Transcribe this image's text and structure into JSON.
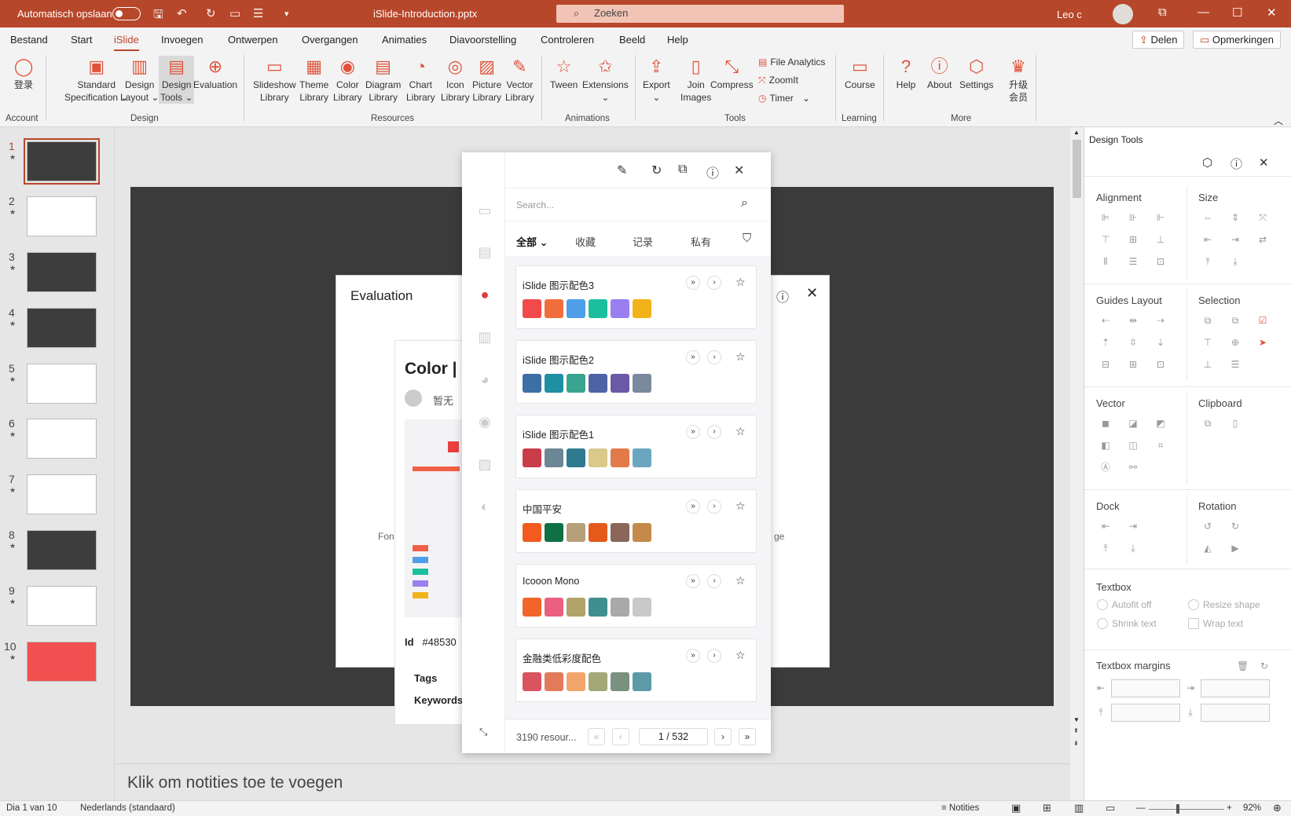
{
  "titlebar": {
    "autosave_label": "Automatisch opslaan",
    "filename": "iSlide-Introduction.pptx",
    "search_placeholder": "Zoeken",
    "user_name": "Leo c"
  },
  "menu": {
    "items": [
      "Bestand",
      "Start",
      "iSlide",
      "Invoegen",
      "Ontwerpen",
      "Overgangen",
      "Animaties",
      "Diavoorstelling",
      "Controleren",
      "Beeld",
      "Help"
    ],
    "active": "iSlide",
    "share_label": "Delen",
    "comments_label": "Opmerkingen"
  },
  "ribbon": {
    "account": {
      "login": "登录",
      "group": "Account"
    },
    "design": {
      "standard_1": "Standard",
      "standard_2": "Specification",
      "layout_1": "Design",
      "layout_2": "Layout",
      "tools_1": "Design",
      "tools_2": "Tools",
      "evaluation": "Evaluation",
      "group": "Design"
    },
    "resources": {
      "items": [
        [
          "Slideshow",
          "Library"
        ],
        [
          "Theme",
          "Library"
        ],
        [
          "Color",
          "Library"
        ],
        [
          "Diagram",
          "Library"
        ],
        [
          "Chart",
          "Library"
        ],
        [
          "Icon",
          "Library"
        ],
        [
          "Picture",
          "Library"
        ],
        [
          "Vector",
          "Library"
        ]
      ],
      "group": "Resources"
    },
    "animations": {
      "tween": "Tween",
      "extensions": "Extensions",
      "group": "Animations"
    },
    "tools": {
      "export": "Export",
      "join_1": "Join",
      "join_2": "Images",
      "compress": "Compress",
      "file_analytics": "File Analytics",
      "zoomit": "ZoomIt",
      "timer": "Timer",
      "group": "Tools"
    },
    "learning": {
      "course": "Course",
      "group": "Learning"
    },
    "more": {
      "help": "Help",
      "about": "About",
      "settings": "Settings",
      "upgrade_1": "升级",
      "upgrade_2": "会员",
      "group": "More"
    }
  },
  "thumbnails": [
    "1",
    "2",
    "3",
    "4",
    "5",
    "6",
    "7",
    "8",
    "9",
    "10"
  ],
  "evaluation": {
    "title": "Evaluation",
    "card_title": "Color |",
    "card_user": "暂无",
    "card_id_label": "Id",
    "card_id_value": "#48530",
    "tags_label": "Tags",
    "keywords_label": "Keywords",
    "left_cut": "Fon",
    "right_cut": "ge"
  },
  "library_panel": {
    "search_placeholder": "Search...",
    "tabs": [
      "全部",
      "收藏",
      "记录",
      "私有"
    ],
    "palettes": [
      {
        "name": "iSlide 图示配色3",
        "colors": [
          "#f24a4a",
          "#f26d3d",
          "#4f9ee8",
          "#1bbf9e",
          "#9a7ff0",
          "#f2b21a"
        ]
      },
      {
        "name": "iSlide 图示配色2",
        "colors": [
          "#3d6fa6",
          "#1f8fa3",
          "#3aa58f",
          "#4f62a6",
          "#6c5aa6",
          "#7a8a9c"
        ]
      },
      {
        "name": "iSlide 图示配色1",
        "colors": [
          "#c93c4a",
          "#6b8694",
          "#2f7a8f",
          "#d9c98a",
          "#e37a4a",
          "#6aa7bf"
        ]
      },
      {
        "name": "中国平安",
        "colors": [
          "#f25a1f",
          "#0f7044",
          "#b5a07a",
          "#e5591b",
          "#8a6758",
          "#c48a4a"
        ]
      },
      {
        "name": "Icooon Mono",
        "colors": [
          "#f2652a",
          "#ec5f7f",
          "#b0a46a",
          "#3f8f8f",
          "#a9a9a9",
          "#c9c9c9"
        ]
      },
      {
        "name": "金融类低彩度配色",
        "colors": [
          "#d9545e",
          "#e37a5a",
          "#f2a56a",
          "#a2a876",
          "#7a9080",
          "#5c9aa8"
        ]
      }
    ],
    "count": "3190 resour...",
    "page": "1 / 532"
  },
  "notes": {
    "placeholder": "Klik om notities toe te voegen"
  },
  "design_tools": {
    "title": "Design Tools",
    "sections": [
      "Alignment",
      "Size",
      "Guides Layout",
      "Selection",
      "Vector",
      "Clipboard",
      "Dock",
      "Rotation"
    ],
    "textbox": {
      "title": "Textbox",
      "autofit_off": "Autofit off",
      "resize_shape": "Resize shape",
      "shrink_text": "Shrink text",
      "wrap_text": "Wrap text"
    },
    "margins_title": "Textbox margins"
  },
  "status": {
    "slide_info": "Dia 1 van 10",
    "language": "Nederlands (standaard)",
    "notes": "Notities",
    "zoom": "92%"
  }
}
